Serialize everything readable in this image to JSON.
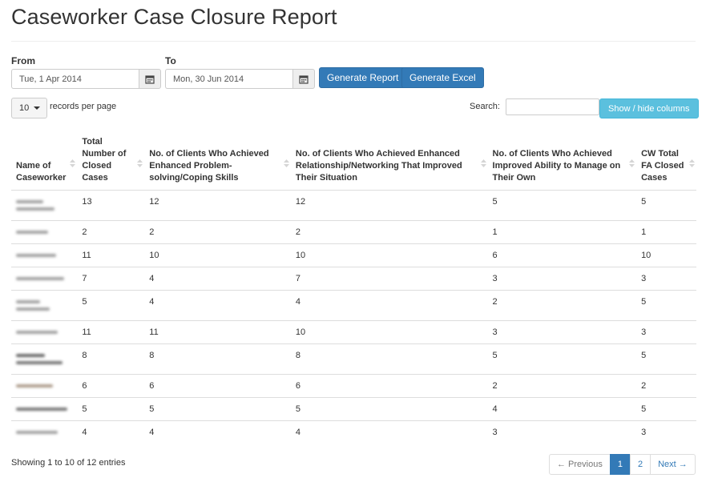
{
  "page_title": "Caseworker Case Closure Report",
  "filters": {
    "from_label": "From",
    "to_label": "To",
    "from_value": "Tue, 1 Apr 2014",
    "to_value": "Mon, 30 Jun 2014"
  },
  "actions": {
    "generate_report": "Generate Report",
    "generate_excel": "Generate Excel",
    "show_hide_columns": "Show / hide columns"
  },
  "table_controls": {
    "page_length": "10",
    "records_per_page": "records per page",
    "search_label": "Search:",
    "search_value": ""
  },
  "columns": [
    "Name of Caseworker",
    "Total Number of Closed Cases",
    "No. of Clients Who Achieved Enhanced Problem-solving/Coping Skills",
    "No. of Clients Who Achieved Enhanced Relationship/Networking That Improved Their Situation",
    "No. of Clients Who Achieved Improved Ability to Manage on Their Own",
    "CW Total FA Closed Cases"
  ],
  "rows": [
    {
      "values": [
        "13",
        "12",
        "12",
        "5",
        "5"
      ]
    },
    {
      "values": [
        "2",
        "2",
        "2",
        "1",
        "1"
      ]
    },
    {
      "values": [
        "11",
        "10",
        "10",
        "6",
        "10"
      ]
    },
    {
      "values": [
        "7",
        "4",
        "7",
        "3",
        "3"
      ]
    },
    {
      "values": [
        "5",
        "4",
        "4",
        "2",
        "5"
      ]
    },
    {
      "values": [
        "11",
        "11",
        "10",
        "3",
        "3"
      ]
    },
    {
      "values": [
        "8",
        "8",
        "8",
        "5",
        "5"
      ]
    },
    {
      "values": [
        "6",
        "6",
        "6",
        "2",
        "2"
      ]
    },
    {
      "values": [
        "5",
        "5",
        "5",
        "4",
        "5"
      ]
    },
    {
      "values": [
        "4",
        "4",
        "4",
        "3",
        "3"
      ]
    }
  ],
  "footer": {
    "showing": "Showing 1 to 10 of 12 entries",
    "previous": "← Previous",
    "pages": [
      "1",
      "2"
    ],
    "next": "Next →"
  },
  "colors": {
    "primary": "#337ab7",
    "info": "#5bc0de",
    "border": "#dddddd"
  },
  "icons": [
    "calendar-icon",
    "caret-down-icon",
    "sort-icon"
  ]
}
